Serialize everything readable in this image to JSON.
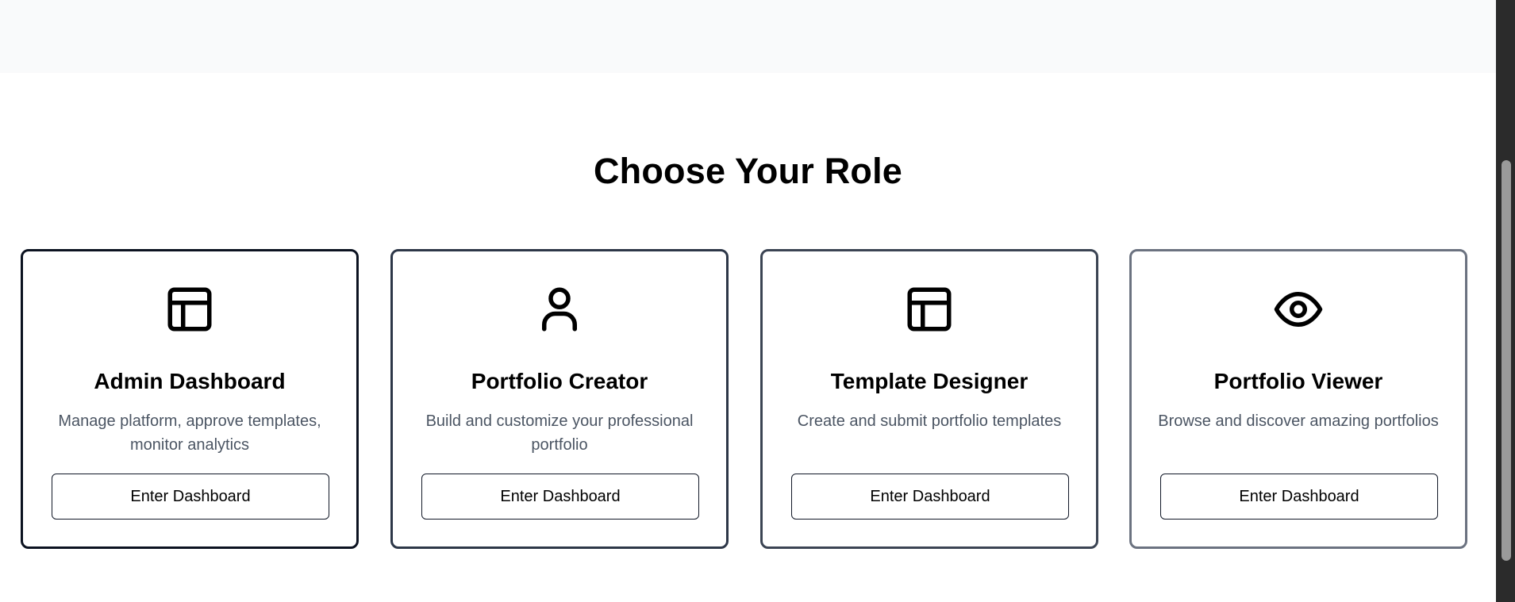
{
  "section": {
    "title": "Choose Your Role"
  },
  "cards": [
    {
      "icon": "layout-icon",
      "title": "Admin Dashboard",
      "description": "Manage platform, approve templates, monitor analytics",
      "button_label": "Enter Dashboard"
    },
    {
      "icon": "user-icon",
      "title": "Portfolio Creator",
      "description": "Build and customize your professional portfolio",
      "button_label": "Enter Dashboard"
    },
    {
      "icon": "layout-icon",
      "title": "Template Designer",
      "description": "Create and submit portfolio templates",
      "button_label": "Enter Dashboard"
    },
    {
      "icon": "eye-icon",
      "title": "Portfolio Viewer",
      "description": "Browse and discover amazing portfolios",
      "button_label": "Enter Dashboard"
    }
  ],
  "colors": {
    "top_band": "#f9fafb",
    "description_text": "#4b5563",
    "border_dark": "#111827"
  }
}
